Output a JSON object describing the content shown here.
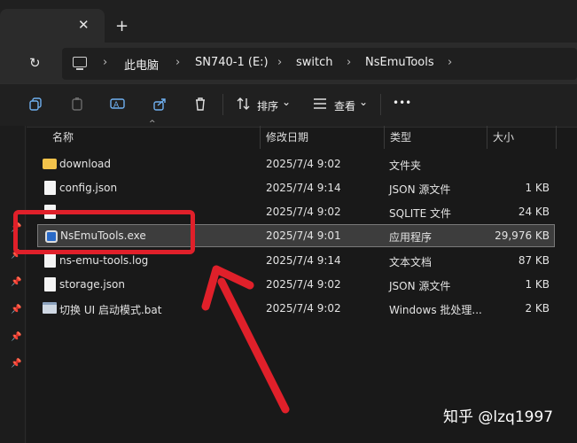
{
  "tab": {
    "close_glyph": "✕",
    "new_tab_glyph": "+"
  },
  "address": {
    "refresh_glyph": "↻",
    "crumbs": [
      "此电脑",
      "SN740-1 (E:)",
      "switch",
      "NsEmuTools"
    ],
    "separator": "›"
  },
  "toolbar": {
    "sort_label": "排序",
    "view_label": "查看",
    "more_label": "•••",
    "dropdown_glyph": "⌄",
    "icons": [
      "copy-icon",
      "paste-icon",
      "rename-icon",
      "share-icon",
      "delete-icon",
      "sort-icon",
      "view-icon",
      "more-icon"
    ]
  },
  "columns": {
    "name": "名称",
    "modified": "修改日期",
    "type": "类型",
    "size": "大小",
    "sort_glyph": "^"
  },
  "files": [
    {
      "name": "download",
      "modified": "2025/7/4 9:02",
      "type": "文件夹",
      "size": "",
      "icon": "folder-icon",
      "selected": false
    },
    {
      "name": "config.json",
      "modified": "2025/7/4 9:14",
      "type": "JSON 源文件",
      "size": "1 KB",
      "icon": "file-icon",
      "selected": false
    },
    {
      "name": "",
      "modified": "2025/7/4 9:02",
      "type": "SQLITE 文件",
      "size": "24 KB",
      "icon": "file-icon",
      "selected": false
    },
    {
      "name": "NsEmuTools.exe",
      "modified": "2025/7/4 9:01",
      "type": "应用程序",
      "size": "29,976 KB",
      "icon": "exe-icon",
      "selected": true
    },
    {
      "name": "ns-emu-tools.log",
      "modified": "2025/7/4 9:14",
      "type": "文本文档",
      "size": "87 KB",
      "icon": "file-icon",
      "selected": false
    },
    {
      "name": "storage.json",
      "modified": "2025/7/4 9:02",
      "type": "JSON 源文件",
      "size": "1 KB",
      "icon": "file-icon",
      "selected": false
    },
    {
      "name": "切换 UI 启动模式.bat",
      "modified": "2025/7/4 9:02",
      "type": "Windows 批处理...",
      "size": "2 KB",
      "icon": "bat-icon",
      "selected": false
    }
  ],
  "pins": [
    "pin-icon",
    "pin-icon",
    "pin-icon",
    "pin-icon",
    "pin-icon",
    "pin-icon"
  ],
  "pin_glyph": "📌",
  "watermark": "知乎 @lzq1997",
  "colors": {
    "background": "#191919",
    "accent": "#6fb0f0",
    "annotation": "#e0202a",
    "folder": "#f2c34b"
  }
}
